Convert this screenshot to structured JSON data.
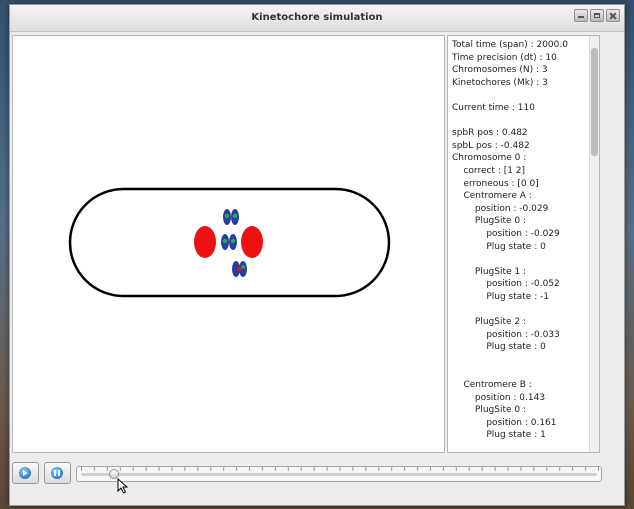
{
  "window": {
    "title": "Kinetochore simulation",
    "controls": [
      "minimize-icon",
      "maximize-icon",
      "close-icon"
    ]
  },
  "info": {
    "lines": [
      "Total time (span) : 2000.0",
      "Time precision (dt) : 10",
      "Chromosomes (N) : 3",
      "Kinetochores (Mk) : 3",
      "",
      "Current time : 110",
      "",
      "spbR pos : 0.482",
      "spbL pos : -0.482",
      "Chromosome 0 :",
      "    correct : [1 2]",
      "    erroneous : [0 0]",
      "    Centromere A :",
      "        position : -0.029",
      "        PlugSite 0 :",
      "            position : -0.029",
      "            Plug state : 0",
      "",
      "        PlugSite 1 :",
      "            position : -0.052",
      "            Plug state : -1",
      "",
      "        PlugSite 2 :",
      "            position : -0.033",
      "            Plug state : 0",
      "",
      "",
      "    Centromere B :",
      "        position : 0.143",
      "        PlugSite 0 :",
      "            position : 0.161",
      "            Plug state : 1"
    ]
  },
  "controls": {
    "play_icon": "play-icon",
    "pause_icon": "pause-icon",
    "time_slider_fraction": 0.055
  },
  "colors": {
    "spindle_pole": "#ee1111",
    "kinetochore_blue": "#2a3ea0",
    "kinetochore_green": "#22b24c",
    "cell_outline": "#000000"
  }
}
